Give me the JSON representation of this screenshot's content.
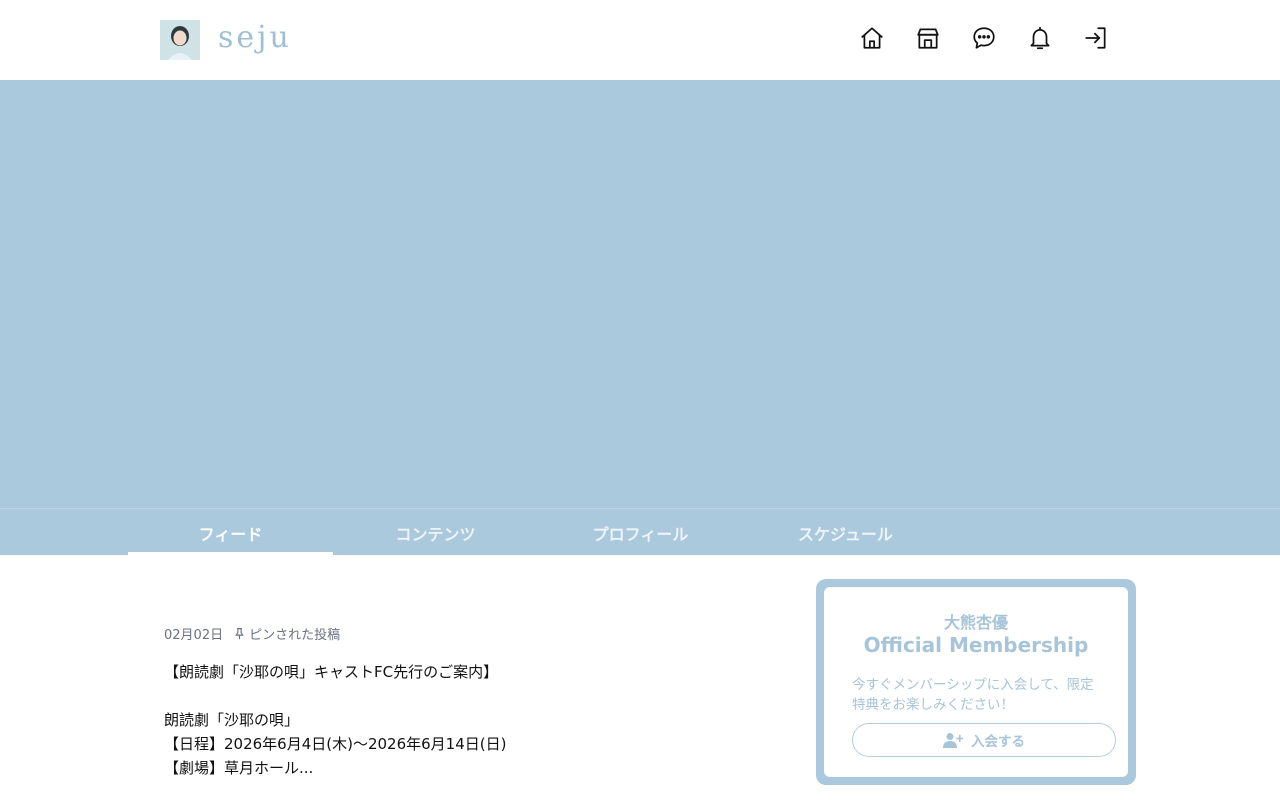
{
  "header": {
    "logo_text": "seju",
    "nav_icons": [
      "home-icon",
      "shop-icon",
      "chat-icon",
      "bell-icon",
      "login-icon"
    ]
  },
  "tabs": [
    {
      "label": "フィード",
      "active": true
    },
    {
      "label": "コンテンツ",
      "active": false
    },
    {
      "label": "プロフィール",
      "active": false
    },
    {
      "label": "スケジュール",
      "active": false
    }
  ],
  "post": {
    "date": "02月02日",
    "pinned_label": "ピンされた投稿",
    "lines": [
      "【朗読劇「沙耶の唄」キャストFC先行のご案内】",
      "",
      "朗読劇「沙耶の唄」",
      "【日程】2026年6月4日(木)〜2026年6月14日(日)",
      "【劇場】草月ホール..."
    ]
  },
  "membership": {
    "name": "大熊杏優",
    "title": "Official Membership",
    "description": "今すぐメンバーシップに入会して、限定特典をお楽しみください！",
    "join_label": "入会する"
  },
  "colors": {
    "accent": "#abc9dd",
    "accent_text": "#a7c4d8"
  }
}
